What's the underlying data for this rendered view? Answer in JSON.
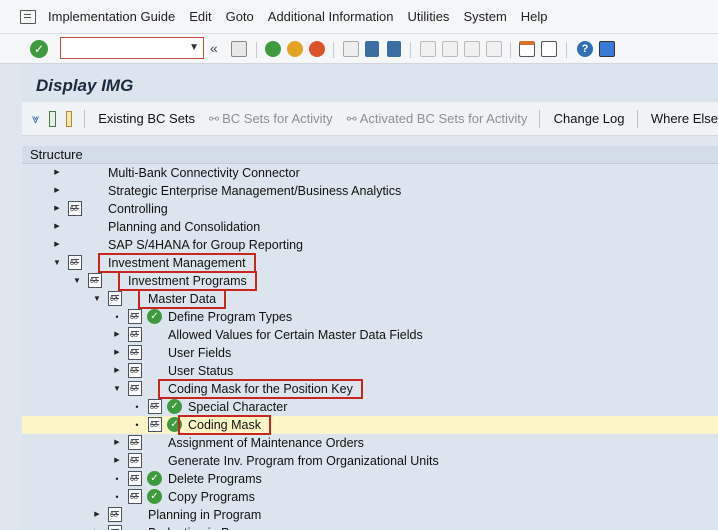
{
  "menubar": {
    "items": [
      "Implementation Guide",
      "Edit",
      "Goto",
      "Additional Information",
      "Utilities",
      "System",
      "Help"
    ]
  },
  "toolbar": {
    "command_value": "",
    "back_symbol": "«"
  },
  "title": "Display IMG",
  "app_toolbar": {
    "existing_bc_sets": "Existing BC Sets",
    "bc_sets_for_activity": "BC Sets for Activity",
    "activated_bc_sets": "Activated BC Sets for Activity",
    "change_log": "Change Log",
    "where_else": "Where Else"
  },
  "tree": {
    "header": "Structure",
    "rows": [
      {
        "label": "Multi-Bank Connectivity Connector",
        "level": 0,
        "expander": "collapsed",
        "icon": "none"
      },
      {
        "label": "Strategic Enterprise Management/Business Analytics",
        "level": 0,
        "expander": "collapsed",
        "icon": "none"
      },
      {
        "label": "Controlling",
        "level": 0,
        "expander": "collapsed",
        "icon": "doc"
      },
      {
        "label": "Planning and Consolidation",
        "level": 0,
        "expander": "collapsed",
        "icon": "none"
      },
      {
        "label": "SAP S/4HANA for Group Reporting",
        "level": 0,
        "expander": "collapsed",
        "icon": "none"
      },
      {
        "label": "Investment Management",
        "level": 0,
        "expander": "expanded",
        "icon": "doc",
        "highlight": true
      },
      {
        "label": "Investment Programs",
        "level": 1,
        "expander": "expanded",
        "icon": "doc",
        "highlight": true
      },
      {
        "label": "Master Data",
        "level": 2,
        "expander": "expanded",
        "icon": "doc",
        "highlight": true
      },
      {
        "label": "Define Program Types",
        "level": 3,
        "expander": "leaf",
        "icon": "doc-clock"
      },
      {
        "label": "Allowed Values for Certain Master Data Fields",
        "level": 3,
        "expander": "collapsed",
        "icon": "doc"
      },
      {
        "label": "User Fields",
        "level": 3,
        "expander": "collapsed",
        "icon": "doc"
      },
      {
        "label": "User Status",
        "level": 3,
        "expander": "collapsed",
        "icon": "doc"
      },
      {
        "label": "Coding Mask for the Position Key",
        "level": 3,
        "expander": "expanded",
        "icon": "doc",
        "highlight": true
      },
      {
        "label": "Special Character",
        "level": 4,
        "expander": "leaf",
        "icon": "doc-clock"
      },
      {
        "label": "Coding Mask",
        "level": 4,
        "expander": "leaf",
        "icon": "doc-clock",
        "highlight": true,
        "selected": true
      },
      {
        "label": "Assignment of Maintenance Orders",
        "level": 3,
        "expander": "collapsed",
        "icon": "doc"
      },
      {
        "label": "Generate Inv. Program from Organizational Units",
        "level": 3,
        "expander": "collapsed",
        "icon": "doc"
      },
      {
        "label": "Delete Programs",
        "level": 3,
        "expander": "leaf",
        "icon": "doc-clock"
      },
      {
        "label": "Copy Programs",
        "level": 3,
        "expander": "leaf",
        "icon": "doc-clock"
      },
      {
        "label": "Planning in Program",
        "level": 2,
        "expander": "collapsed",
        "icon": "doc"
      },
      {
        "label": "Budgeting in Program",
        "level": 2,
        "expander": "collapsed",
        "icon": "doc"
      }
    ]
  },
  "colors": {
    "highlight_border": "#c8261d",
    "selected_row": "#fbf5c8",
    "tree_bg": "#dce5ee",
    "ok_green": "#3e9a3e"
  }
}
